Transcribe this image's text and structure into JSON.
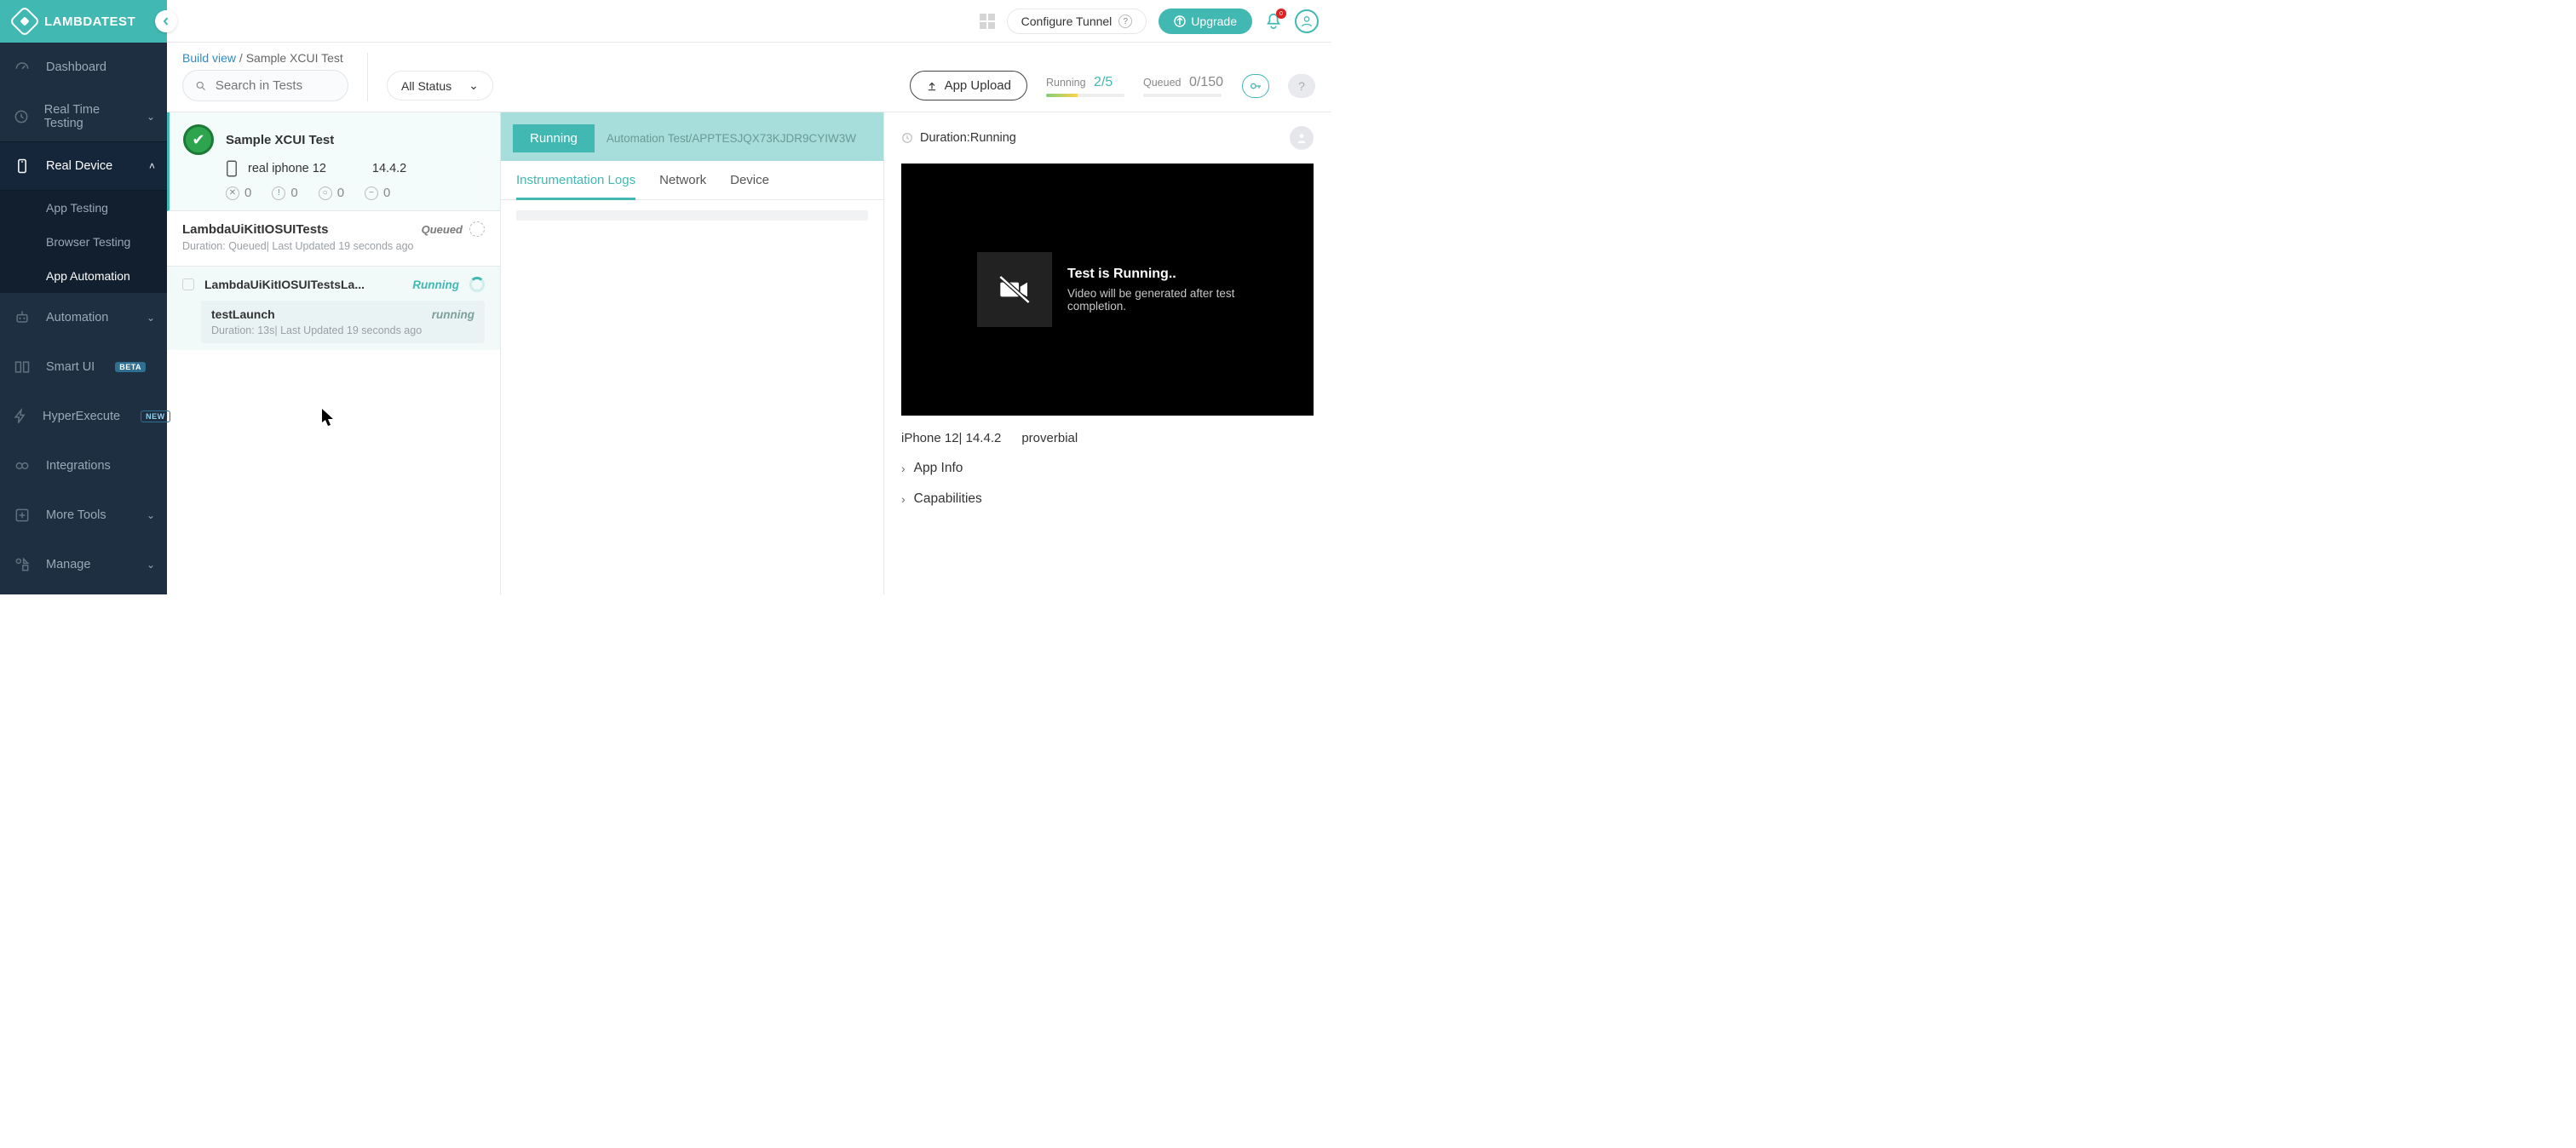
{
  "header": {
    "brand": "LAMBDATEST",
    "configure_tunnel": "Configure Tunnel",
    "upgrade": "Upgrade",
    "notifications": "0"
  },
  "sidebar": {
    "items": [
      {
        "label": "Dashboard"
      },
      {
        "label": "Real Time Testing",
        "expandable": true
      },
      {
        "label": "Real Device",
        "expandable": true,
        "active": true
      },
      {
        "label": "Automation",
        "expandable": true
      },
      {
        "label": "Smart UI",
        "badge": "BETA"
      },
      {
        "label": "HyperExecute",
        "badge": "NEW"
      },
      {
        "label": "Integrations"
      },
      {
        "label": "More Tools",
        "expandable": true
      },
      {
        "label": "Manage",
        "expandable": true
      }
    ],
    "sub_items": [
      {
        "label": "App Testing"
      },
      {
        "label": "Browser Testing"
      },
      {
        "label": "App Automation",
        "selected": true
      }
    ]
  },
  "breadcrumb": {
    "root": "Build view",
    "current": "Sample XCUI Test"
  },
  "toolbar": {
    "search_placeholder": "Search in Tests",
    "status_filter": "All Status",
    "app_upload": "App Upload",
    "running_label": "Running",
    "running_value": "2/5",
    "queued_label": "Queued",
    "queued_value": "0/150"
  },
  "build": {
    "title": "Sample XCUI Test",
    "device": "real iphone 12",
    "os_version": "14.4.2",
    "counts": {
      "failed": "0",
      "error": "0",
      "skipped": "0",
      "ignored": "0"
    }
  },
  "suite": {
    "title": "LambdaUiKitIOSUITests",
    "status": "Queued",
    "meta": "Duration: Queued| Last Updated 19 seconds ago"
  },
  "test_case": {
    "title": "LambdaUiKitIOSUITestsLa...",
    "status": "Running",
    "subtest": {
      "title": "testLaunch",
      "status": "running",
      "meta": "Duration: 13s| Last Updated 19 seconds ago"
    }
  },
  "log_panel": {
    "banner_status": "Running",
    "banner_path": "Automation Test/APPTESJQX73KJDR9CYIW3W",
    "tabs": [
      "Instrumentation Logs",
      "Network",
      "Device"
    ]
  },
  "detail": {
    "duration_label": "Duration: ",
    "duration_value": "Running",
    "video_title": "Test is Running..",
    "video_body": "Video will be generated after test completion.",
    "device": "iPhone 12| 14.4.2",
    "app": "proverbial",
    "expanders": [
      "App Info",
      "Capabilities"
    ]
  }
}
